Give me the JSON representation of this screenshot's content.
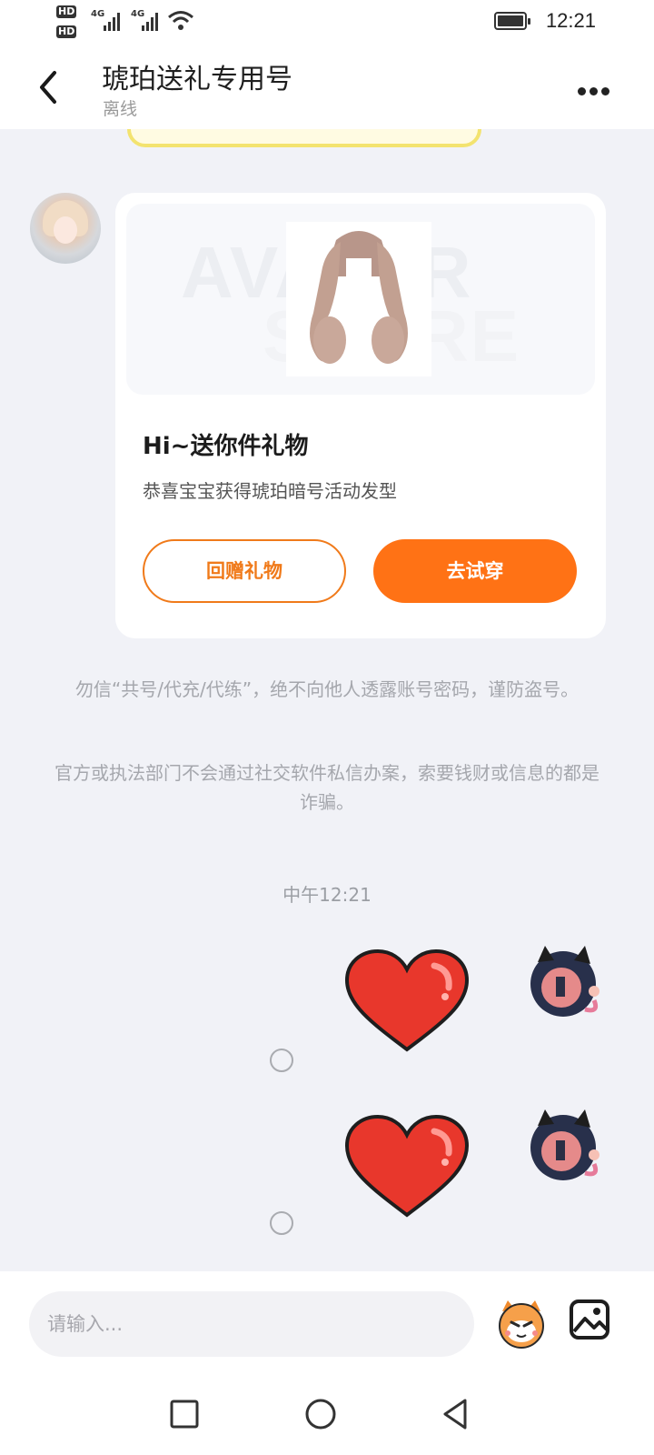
{
  "status_bar": {
    "time": "12:21",
    "network": "4G",
    "hd1": "HD",
    "hd2": "HD"
  },
  "header": {
    "title": "琥珀送礼专用号",
    "status": "离线"
  },
  "gift_card": {
    "watermark_1": "AVATAR",
    "watermark_2": "STORE",
    "title": "Hi~送你件礼物",
    "subtitle": "恭喜宝宝获得琥珀暗号活动发型",
    "return_gift_label": "回赠礼物",
    "try_on_label": "去试穿"
  },
  "notices": {
    "line1": "勿信“共号/代充/代练”，绝不向他人透露账号密码，谨防盗号。",
    "line2": "官方或执法部门不会通过社交软件私信办案，索要钱财或信息的都是诈骗。"
  },
  "timestamp": "中午12:21",
  "input": {
    "placeholder": "请输入..."
  },
  "colors": {
    "accent": "#ff7215",
    "heart": "#e8372c",
    "background": "#f1f2f7"
  }
}
